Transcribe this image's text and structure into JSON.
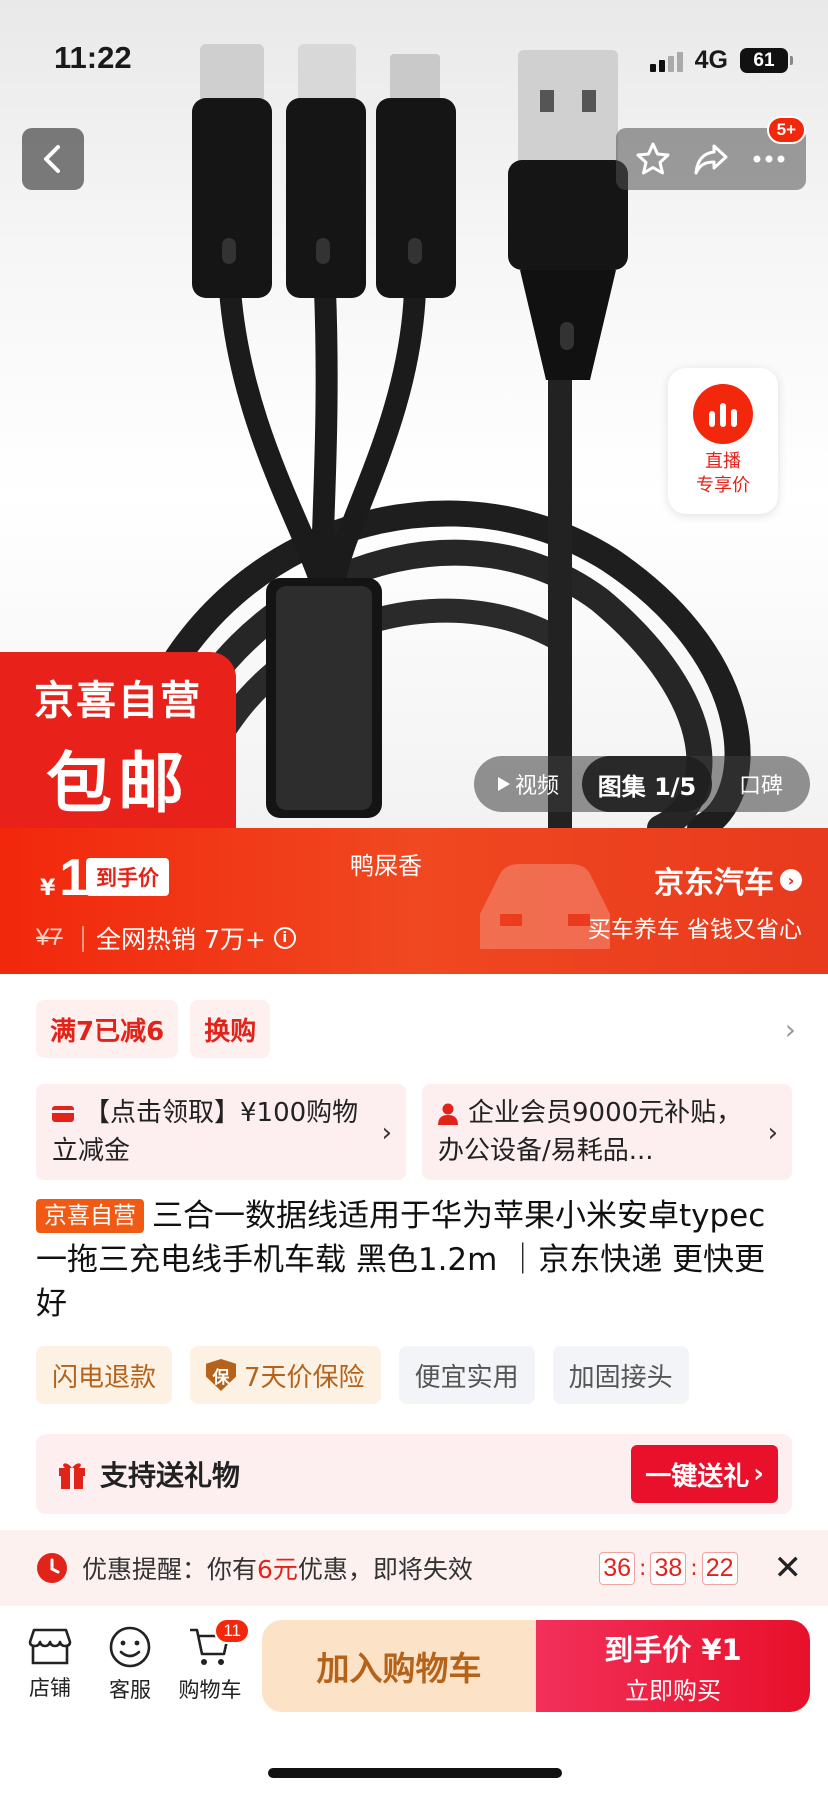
{
  "status_bar": {
    "time": "11:22",
    "network": "4G",
    "battery": "61"
  },
  "top_bar": {
    "message_badge": "5+"
  },
  "live": {
    "line1": "直播",
    "line2": "专享价"
  },
  "badge": {
    "line1": "京喜自营",
    "line2": "包邮"
  },
  "media_tabs": {
    "video": "视频",
    "gallery": "图集 1/5",
    "reviews": "口碑"
  },
  "price": {
    "currency": "¥",
    "value": "1",
    "tag": "到手价",
    "original": "¥7",
    "hot": "全网热销 7万+",
    "middle_text": "鸭屎香",
    "ad_title": "京东汽车",
    "ad_sub": "买车养车 省钱又省心"
  },
  "promotions": {
    "chip1": "满7已减6",
    "chip2": "换购"
  },
  "coupons": [
    {
      "text": "【点击领取】¥100购物立减金"
    },
    {
      "text": "企业会员9000元补贴，办公设备/易耗品..."
    }
  ],
  "product": {
    "store_tag": "京喜自营",
    "title": "三合一数据线适用于华为苹果小米安卓typec一拖三充电线手机车载 黑色1.2m ｜京东快递 更快更好"
  },
  "tags": {
    "t1": "闪电退款",
    "t2_icon": "保",
    "t2": "7天价保险",
    "t3": "便宜实用",
    "t4": "加固接头"
  },
  "gift": {
    "label": "支持送礼物",
    "button": "一键送礼"
  },
  "reminder": {
    "prefix": "优惠提醒：你有",
    "amount": "6元",
    "suffix": "优惠，即将失效",
    "hours": "36",
    "minutes": "38",
    "seconds": "22"
  },
  "bottom": {
    "store": "店铺",
    "service": "客服",
    "cart": "购物车",
    "cart_count": "11",
    "add_cart": "加入购物车",
    "buy_line1": "到手价 ¥1",
    "buy_line2": "立即购买"
  },
  "colors": {
    "brand_red": "#f2270c",
    "buy_red": "#e8102a",
    "cart_bg": "#fce3c7",
    "cart_text": "#b5621a"
  },
  "icons": [
    "back-icon",
    "star-icon",
    "share-icon",
    "more-icon",
    "live-icon",
    "play-icon",
    "info-icon",
    "card-icon",
    "person-icon",
    "shield-icon",
    "gift-icon",
    "clock-icon",
    "close-icon",
    "store-icon",
    "service-icon",
    "cart-icon"
  ]
}
